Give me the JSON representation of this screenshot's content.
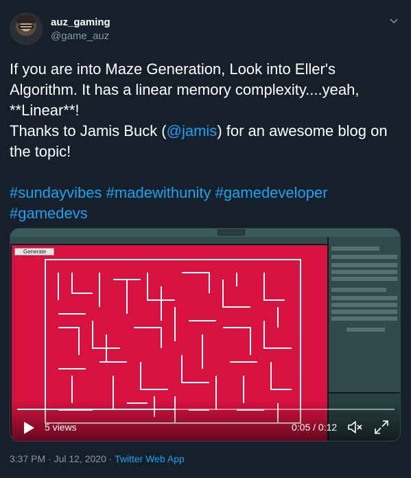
{
  "author": {
    "display_name": "auz_gaming",
    "handle": "@game_auz",
    "avatar_icon": "user-avatar"
  },
  "menu_icon": "chevron-down-icon",
  "tweet": {
    "line1": "If you are into Maze Generation, Look into Eller's",
    "line2": "Algorithm. It has a linear memory complexity....yeah,",
    "line3": "**Linear**!",
    "line4_before": "Thanks to Jamis Buck (",
    "line4_mention": "@jamis",
    "line4_after": ") for an awesome blog on",
    "line5": "the topic!",
    "hashtag1": "#sundayvibes",
    "hashtag2": "#madewithunity",
    "hashtag3": "#gamedeveloper",
    "hashtag4": "#gamedevs"
  },
  "video": {
    "generate_button": "Generate",
    "views": "5 views",
    "time": "0:05 / 0:12",
    "progress": 0.42,
    "play_icon": "play-icon",
    "mute_icon": "muted-speaker-icon",
    "fullscreen_icon": "fullscreen-icon"
  },
  "meta": {
    "time": "3:37 PM",
    "separator1": " · ",
    "date": "Jul 12, 2020",
    "separator2": " · ",
    "source": "Twitter Web App"
  },
  "colors": {
    "background": "#15202b",
    "link": "#1da1f2",
    "muted": "#8899a6",
    "game_view": "#d8123f"
  }
}
